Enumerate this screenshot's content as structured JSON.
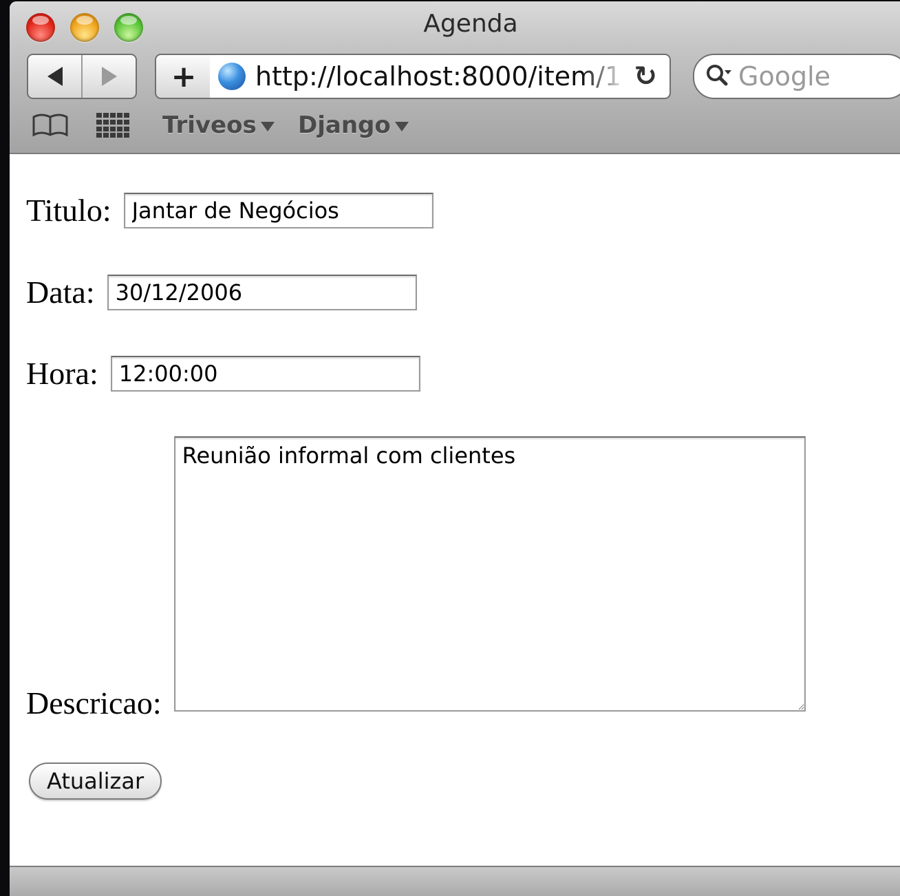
{
  "window": {
    "title": "Agenda"
  },
  "toolbar": {
    "add_label": "+",
    "url": "http://localhost:8000/item/1",
    "search_placeholder": "Google"
  },
  "bookmarks": [
    {
      "label": "Triveos"
    },
    {
      "label": "Django"
    }
  ],
  "form": {
    "titulo": {
      "label": "Titulo:",
      "value": "Jantar de Negócios"
    },
    "data": {
      "label": "Data:",
      "value": "30/12/2006"
    },
    "hora": {
      "label": "Hora:",
      "value": "12:00:00"
    },
    "descricao": {
      "label": "Descricao:",
      "value": "Reunião informal com clientes"
    },
    "submit_label": "Atualizar"
  },
  "icons": {
    "back": "back-arrow-icon",
    "forward": "forward-arrow-icon",
    "globe": "globe-icon",
    "reload": "reload-icon",
    "search": "search-icon",
    "bookmarks": "open-book-icon",
    "top_sites": "grid-icon"
  },
  "colors": {
    "chrome_top": "#d9d9d9",
    "chrome_bottom": "#a3a3a3",
    "close": "#e2281b",
    "minimize": "#f0a51c",
    "maximize": "#5cc53a"
  }
}
